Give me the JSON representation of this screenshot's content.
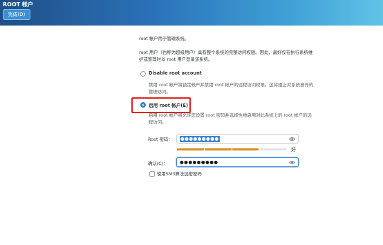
{
  "header": {
    "title": "ROOT 帐户",
    "done_button": "完成(D)"
  },
  "intro": {
    "line1": "root 帐户用于管理系统。",
    "line2": "root 用户（也称为超级用户）具有整个系统的完整访问权限。因此，最好仅在执行系统维",
    "line3": "护或管理时以 root 用户登录该系统。"
  },
  "options": {
    "disable": {
      "label": "Disable root account",
      "desc_line1": "禁用 root 帐户将锁定帐户并禁用 root 帐户的远程访问权限。这将阻止对系统意外的",
      "desc_line2": "管理访问。",
      "checked": false
    },
    "enable": {
      "label": "启用 root 帐户(E)",
      "desc_line1": "启用 root 帐户将允许您设置 root 密码并选择性地启用对此系统上的 root 帐户的远",
      "desc_line2": "程访问。",
      "checked": true
    }
  },
  "form": {
    "password_label": "Root 密码：",
    "password_value": "●●●●●●●●●",
    "confirm_label": "确认(C)：",
    "confirm_value": "●●●●●●●●●",
    "strength_text": "好",
    "strength_fraction": 0.75,
    "sm3_label": "使用SM3算法加密密码",
    "sm3_checked": false
  },
  "icons": {
    "eye": "eye-icon",
    "accent": "#3c84d6",
    "highlight": "#e02020"
  }
}
